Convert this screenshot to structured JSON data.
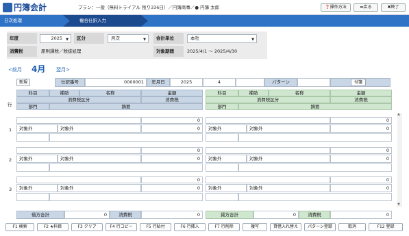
{
  "app": {
    "logo_text": "円簿会計",
    "plan_text": "プラン：一般（無料トライアル 残り336日）／円簿商事／● 円簿 太郎"
  },
  "toolbar": {
    "help": "操作方法",
    "back": "戻る",
    "close": "終了"
  },
  "tabs": [
    {
      "label": "日次処理"
    },
    {
      "label": "複合仕訳入力"
    }
  ],
  "filters": {
    "year_label": "年度",
    "year_value": "2025",
    "period_label": "区分",
    "period_value": "月次",
    "unit_label": "会計単位",
    "unit_value": "本社",
    "tax_label": "消費税",
    "tax_value": "原則課税／税抜処理",
    "range_label": "対象期間",
    "range_value": "2025/4/1 ～ 2025/4/30"
  },
  "month_nav": {
    "prev": "<前月",
    "current": "4月",
    "next": "翌月>"
  },
  "entry": {
    "new_label": "新規",
    "slip_label": "仕訳番号",
    "slip_value": "0000001",
    "date_label": "年月日",
    "year": "2025",
    "month": "4",
    "day": "",
    "pattern_label": "パターン",
    "pattern_value": "",
    "attach_label": "付箋"
  },
  "grid_headers": {
    "row": "行",
    "account": "科目",
    "sub": "補助",
    "name": "名称",
    "amount": "金額",
    "tax_class": "消費税区分",
    "tax": "消費税",
    "dept": "部門",
    "memo": "摘要"
  },
  "rows": [
    {
      "no": "1",
      "debit_amount": "0",
      "debit_tax": "0",
      "debit_tax_class": "対象外",
      "debit_tax_class2": "対象外",
      "credit_amount": "0",
      "credit_tax": "0",
      "credit_tax_class": "対象外",
      "credit_tax_class2": "対象外"
    },
    {
      "no": "2",
      "debit_amount": "0",
      "debit_tax": "0",
      "debit_tax_class": "対象外",
      "debit_tax_class2": "対象外",
      "credit_amount": "0",
      "credit_tax": "0",
      "credit_tax_class": "対象外",
      "credit_tax_class2": "対象外"
    },
    {
      "no": "3",
      "debit_amount": "0",
      "debit_tax": "0",
      "debit_tax_class": "対象外",
      "debit_tax_class2": "対象外",
      "credit_amount": "0",
      "credit_tax": "0",
      "credit_tax_class": "対象外",
      "credit_tax_class2": "対象外"
    }
  ],
  "totals": {
    "debit_label": "借方合計",
    "debit_value": "0",
    "debit_tax_label": "消費税",
    "debit_tax_value": "0",
    "credit_label": "貸方合計",
    "credit_value": "0",
    "credit_tax_label": "消費税",
    "credit_tax_value": "0"
  },
  "fkeys": [
    "F1 検索",
    "F2 ★科目",
    "F3 クリア",
    "F4 行コピー",
    "F5 行貼付",
    "F6 行挿入",
    "F7 行削除",
    "複写",
    "貸借入れ替え",
    "パターン登録",
    "取消",
    "F12 登録"
  ],
  "colors": {
    "header_blue": "#1f5fb0",
    "tab_dark": "#1e4f95",
    "debit_header": "#c9d6e6",
    "credit_header": "#cfe6cf"
  }
}
